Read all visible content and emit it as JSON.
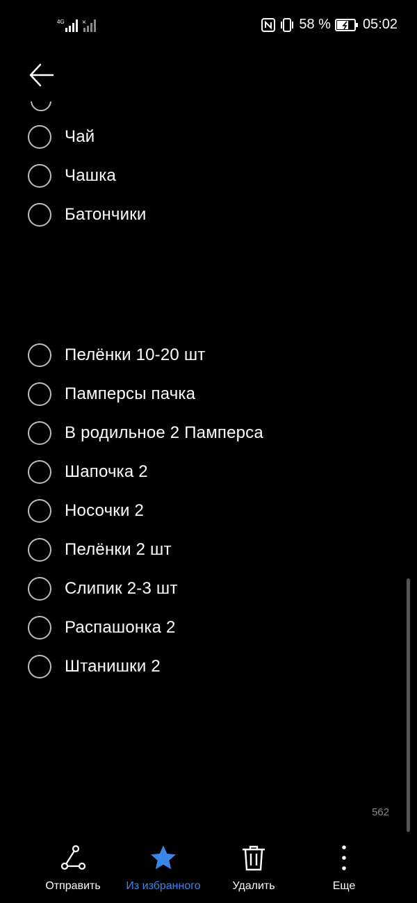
{
  "status_bar": {
    "network": "4G",
    "battery_percent": "58 %",
    "time": "05:02"
  },
  "icons": {
    "back": "arrow-left-icon",
    "nfc": "nfc-icon",
    "vibrate": "vibrate-icon",
    "battery": "battery-charging-icon",
    "signal": "signal-icon"
  },
  "checklist": {
    "items": [
      {
        "label": "Чай",
        "checked": false
      },
      {
        "label": "Чашка",
        "checked": false
      },
      {
        "label": "Батончики",
        "checked": false
      },
      {
        "label": "",
        "checked": false
      },
      {
        "label": "",
        "checked": false
      },
      {
        "label": "Пелёнки 10-20 шт",
        "checked": false
      },
      {
        "label": "Памперсы пачка",
        "checked": false
      },
      {
        "label": "В родильное 2 Памперса",
        "checked": false
      },
      {
        "label": "Шапочка 2",
        "checked": false
      },
      {
        "label": "Носочки 2",
        "checked": false
      },
      {
        "label": "Пелёнки 2 шт",
        "checked": false
      },
      {
        "label": "Слипик 2-3 шт",
        "checked": false
      },
      {
        "label": "Распашонка 2",
        "checked": false
      },
      {
        "label": "Штанишки 2",
        "checked": false
      }
    ]
  },
  "char_count": "562",
  "toolbar": {
    "send_label": "Отправить",
    "favorite_label": "Из избранного",
    "delete_label": "Удалить",
    "more_label": "Еще"
  },
  "colors": {
    "background": "#000000",
    "accent": "#3a86e8",
    "circle": "#bdbdbd"
  }
}
